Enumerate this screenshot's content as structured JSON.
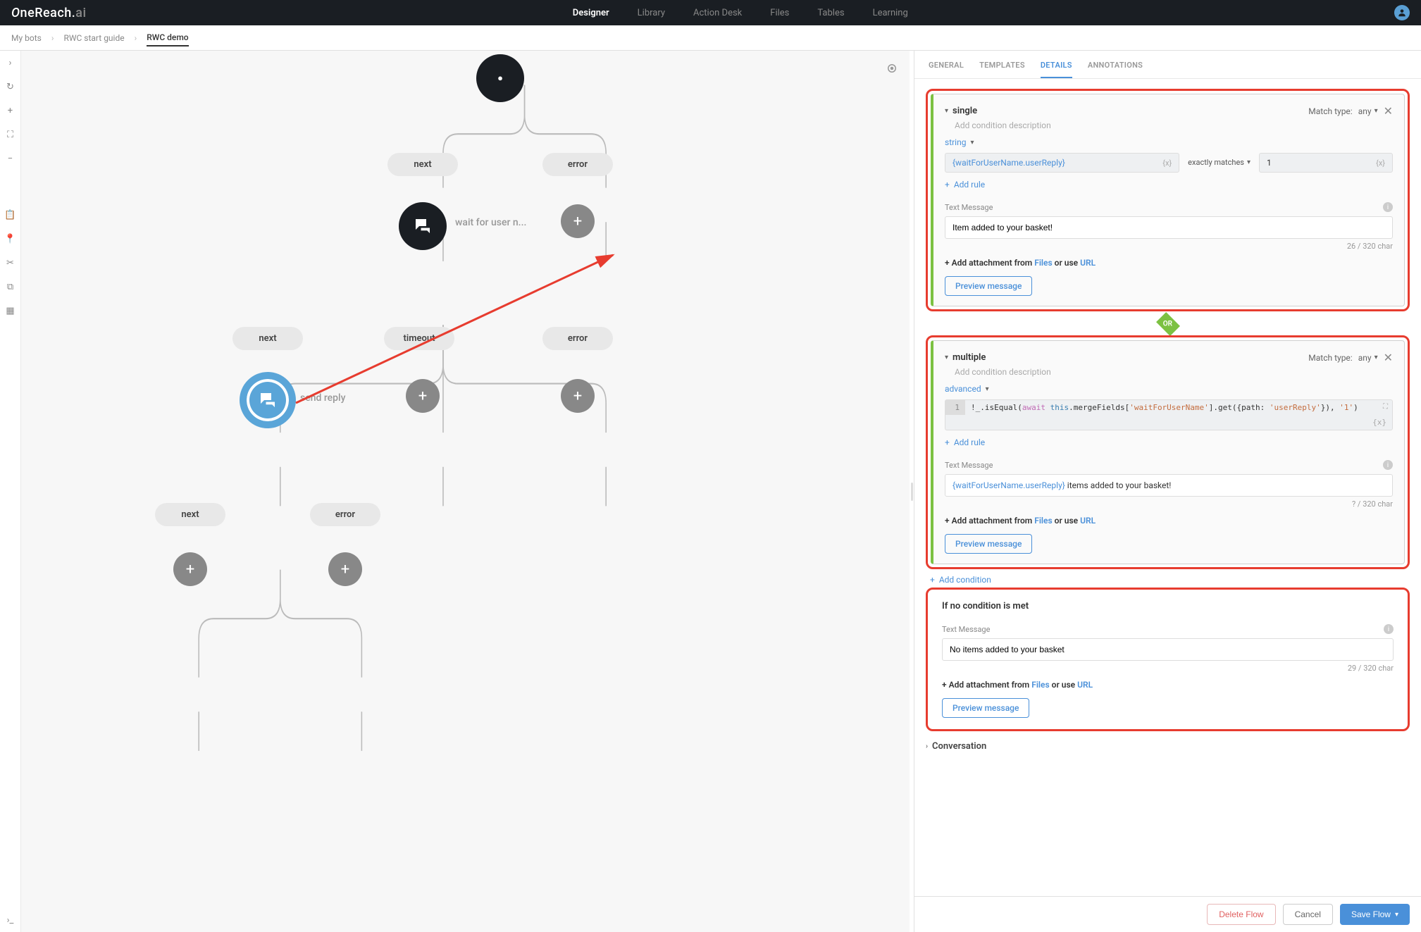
{
  "brand": "OneReach.ai",
  "topnav": [
    "Designer",
    "Library",
    "Action Desk",
    "Files",
    "Tables",
    "Learning"
  ],
  "topnav_active": 0,
  "breadcrumb": [
    "My bots",
    "RWC start guide",
    "RWC demo"
  ],
  "canvas": {
    "pills": {
      "next_top": "next",
      "error_top": "error",
      "next_mid": "next",
      "timeout": "timeout",
      "error_mid": "error",
      "next_bot": "next",
      "error_bot": "error"
    },
    "nodes": {
      "wait": "wait for user n...",
      "send": "send reply"
    }
  },
  "tabs": [
    "GENERAL",
    "TEMPLATES",
    "DETAILS",
    "ANNOTATIONS"
  ],
  "tabs_active": 2,
  "match_type_label": "Match type:",
  "match_type_value": "any",
  "cond1": {
    "title": "single",
    "desc_placeholder": "Add condition description",
    "type": "string",
    "lhs": "{waitForUserName.userReply}",
    "op": "exactly matches",
    "rhs": "1",
    "add_rule": "Add rule",
    "msg_label": "Text Message",
    "msg": "Item added to your basket!",
    "char": "26 / 320 char",
    "attach_prefix": "+ Add attachment from ",
    "attach_files": "Files",
    "attach_mid": " or use ",
    "attach_url": "URL",
    "preview": "Preview message"
  },
  "or_label": "OR",
  "cond2": {
    "title": "multiple",
    "desc_placeholder": "Add condition description",
    "type": "advanced",
    "code": "!_.isEqual(await this.mergeFields['waitForUserName'].get({path: 'userReply'}), '1')",
    "add_rule": "Add rule",
    "msg_label": "Text Message",
    "msg_mf": "{waitForUserName.userReply}",
    "msg_rest": " items added to your basket!",
    "char": "? / 320 char",
    "attach_prefix": "+ Add attachment from ",
    "attach_files": "Files",
    "attach_mid": " or use ",
    "attach_url": "URL",
    "preview": "Preview message"
  },
  "add_condition": "Add condition",
  "fallback": {
    "title": "If no condition is met",
    "msg_label": "Text Message",
    "msg": "No items added to your basket",
    "char": "29 / 320 char",
    "attach_prefix": "+ Add attachment from ",
    "attach_files": "Files",
    "attach_mid": " or use ",
    "attach_url": "URL",
    "preview": "Preview message"
  },
  "conversation": "Conversation",
  "footer": {
    "delete": "Delete Flow",
    "cancel": "Cancel",
    "save": "Save Flow"
  }
}
